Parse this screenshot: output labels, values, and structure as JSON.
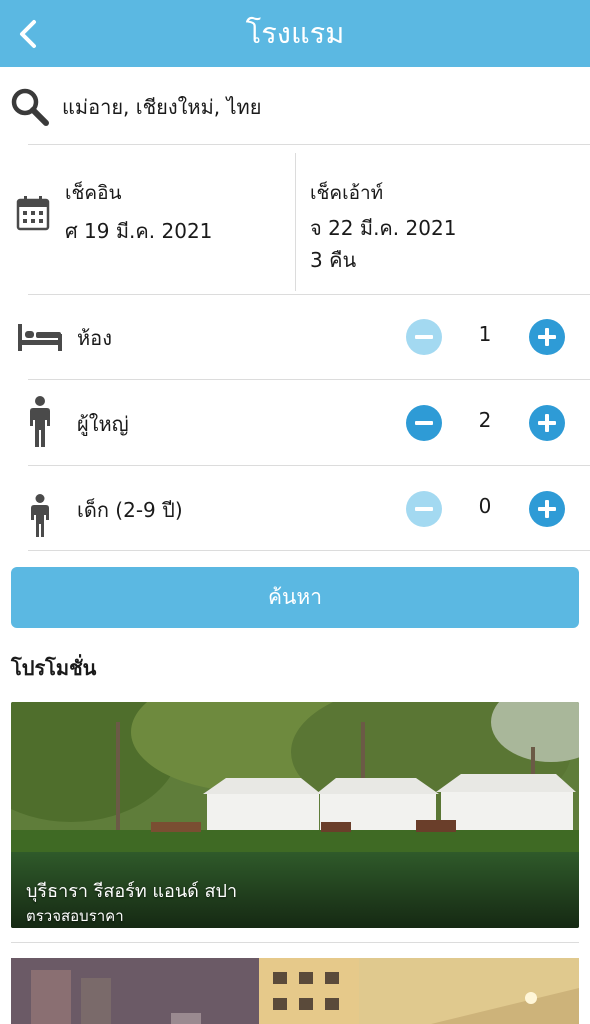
{
  "header": {
    "title": "โรงแรม",
    "back_icon": "chevron-left-icon"
  },
  "search": {
    "location": "แม่อาย, เชียงใหม่, ไทย",
    "icon": "search-icon"
  },
  "dates": {
    "checkin_label": "เช็คอิน",
    "checkin_value": "ศ 19 มี.ค. 2021",
    "checkout_label": "เช็คเอ้าท์",
    "checkout_value": "จ 22 มี.ค. 2021",
    "nights": "3 คืน",
    "icon": "calendar-icon"
  },
  "counters": {
    "rooms": {
      "label": "ห้อง",
      "value": "1",
      "icon": "bed-icon"
    },
    "adults": {
      "label": "ผู้ใหญ่",
      "value": "2",
      "icon": "adult-icon"
    },
    "children": {
      "label": "เด็ก (2-9 ปี)",
      "value": "0",
      "icon": "child-icon"
    }
  },
  "search_button": {
    "label": "ค้นหา"
  },
  "promotions": {
    "title": "โปรโมชั่น",
    "items": [
      {
        "name": "บุรีธารา รีสอร์ท แอนด์ สปา",
        "subtitle": "ตรวจสอบราคา"
      }
    ]
  },
  "colors": {
    "accent": "#5bb8e2",
    "button_active": "#2e9bd6",
    "button_disabled": "#a3d9f1"
  }
}
